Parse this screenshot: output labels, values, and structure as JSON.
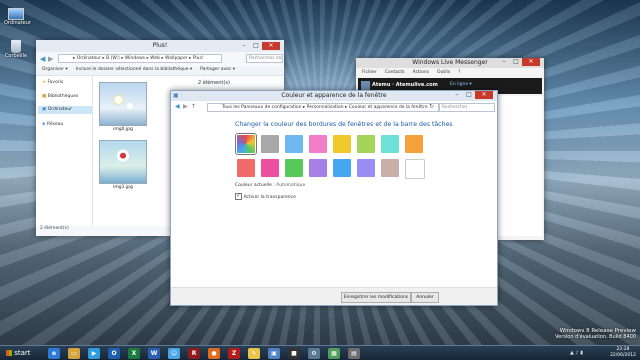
{
  "desktop": {
    "icons": [
      {
        "label": "Ordinateur"
      },
      {
        "label": "Corbeille"
      }
    ],
    "watermark": {
      "line1": "Windows 8 Release Preview",
      "line2": "Version d'évaluation. Build 8400"
    }
  },
  "explorer": {
    "title": "Plus!",
    "menu": [
      "Organiser ▾",
      "Inclure le dossier sélectionné dans la bibliothèque ▾",
      "Partager avec ▾"
    ],
    "address": "▸ Ordinateur ▸ B (W:) ▸ Windows ▸ Web ▸ Wallpaper ▸ Plus!",
    "search_placeholder": "Rechercher dans : Plus!",
    "nav": [
      "Favoris",
      "Bibliothèques",
      "Ordinateur",
      "Réseau"
    ],
    "files": [
      "img0.jpg",
      "img1.jpg"
    ],
    "status": "2 élément(s)",
    "detail": "2 élément(s)"
  },
  "messenger": {
    "title": "Windows Live Messenger",
    "menu": [
      "Fichier",
      "Contacts",
      "Actions",
      "Outils",
      "?"
    ],
    "user": "Atemu · Atemulive.com",
    "status": "En ligne ▾"
  },
  "color_dialog": {
    "title": "Couleur et apparence de la fenêtre",
    "address": "Tous les Panneaux de configuration ▸ Personnalisation ▸ Couleur et apparence de la fenêtre",
    "search_placeholder": "Rechercher",
    "heading": "Changer la couleur des bordures de fenêtres et de la barre des tâches",
    "swatches": [
      "#7a6cc4",
      "#a8a8a8",
      "#6fb8f0",
      "#f07fc8",
      "#f0c82c",
      "#a6d35a",
      "#6de0d8",
      "#f5a23c",
      "#f06a6a",
      "#ec4fa0",
      "#58c85a",
      "#a77ee8",
      "#46a6f2",
      "#9a8cf2",
      "#c8b0a8",
      "#ffffff"
    ],
    "current_label": "Couleur actuelle :",
    "current_value": "Automatique",
    "transparency_label": "Activer la transparence",
    "transparency_checked": true,
    "save_button": "Enregistrer les modifications",
    "cancel_button": "Annuler"
  },
  "taskbar": {
    "start_label": "start",
    "clock_time": "22:28",
    "clock_date": "22/06/2012"
  }
}
